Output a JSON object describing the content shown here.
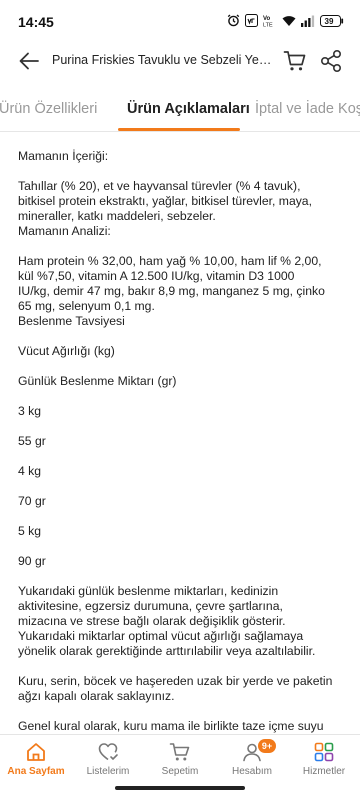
{
  "status_bar": {
    "time": "14:45",
    "battery": "39",
    "icons": [
      "alarm-icon",
      "vowifi-icon",
      "volte-icon",
      "wifi-icon",
      "signal-icon",
      "battery-icon"
    ]
  },
  "header": {
    "back_icon": "arrow-left-icon",
    "title": "Purina Friskies Tavuklu ve Sebzeli Yetişkin Kedi Maması",
    "cart_icon": "cart-icon",
    "share_icon": "share-icon"
  },
  "tabs": [
    {
      "label": "Ürün Özellikleri",
      "active": false
    },
    {
      "label": "Ürün Açıklamaları",
      "active": true
    },
    {
      "label": "İptal ve İade Koşulları",
      "active": false
    }
  ],
  "content": {
    "lines": [
      "Mamanın İçeriği:",
      "Tahıllar (% 20), et ve hayvansal türevler (% 4 tavuk),",
      "bitkisel protein ekstraktı, yağlar, bitkisel türevler, maya,",
      "mineraller, katkı maddeleri, sebzeler.",
      "Mamanın Analizi:",
      "Ham protein % 32,00, ham yağ % 10,00, ham lif % 2,00,",
      "kül %7,50, vitamin A 12.500 IU/kg, vitamin D3 1000",
      "IU/kg, demir 47 mg, bakır 8,9 mg, manganez 5 mg, çinko",
      "65 mg, selenyum 0,1 mg.",
      "Beslenme Tavsiyesi",
      "Vücut Ağırlığı (kg)",
      "Günlük Beslenme Miktarı (gr)",
      "3 kg",
      "55 gr",
      "4 kg",
      "70 gr",
      "5 kg",
      "90 gr",
      "Yukarıdaki günlük beslenme miktarları, kedinizin",
      "aktivitesine, egzersiz durumuna, çevre şartlarına,",
      "mizacına ve strese bağlı olarak değişiklik gösterir.",
      "Yukarıdaki miktarlar optimal vücut ağırlığı sağlamaya",
      "yönelik olarak gerektiğinde arttırılabilir veya azaltılabilir.",
      "Kuru, serin, böcek ve haşereden uzak bir yerde ve paketin",
      "ağzı kapalı olarak saklayınız.",
      "Genel kural olarak, kuru mama ile birlikte taze içme suyu"
    ]
  },
  "bottom_nav": [
    {
      "label": "Ana Sayfam",
      "icon": "home-icon",
      "active": true
    },
    {
      "label": "Listelerim",
      "icon": "heart-list-icon",
      "active": false
    },
    {
      "label": "Sepetim",
      "icon": "cart-icon",
      "active": false
    },
    {
      "label": "Hesabım",
      "icon": "user-icon",
      "active": false,
      "badge": "9+"
    },
    {
      "label": "Hizmetler",
      "icon": "grid-icon",
      "active": false
    }
  ],
  "colors": {
    "accent": "#f27a1a",
    "text": "#222222",
    "muted": "#999999"
  }
}
